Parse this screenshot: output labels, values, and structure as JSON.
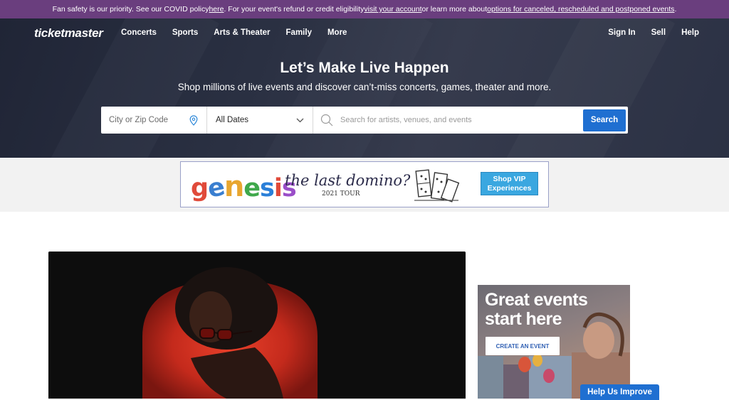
{
  "banner": {
    "text_1": "Fan safety is our priority. See our COVID policy ",
    "link_1": "here",
    "text_2": ". For your event's refund or credit eligibility ",
    "link_2": "visit your account",
    "text_3": " or learn more about ",
    "link_3": "options for canceled, rescheduled and postponed events",
    "text_4": "."
  },
  "nav": {
    "logo": "ticketmaster",
    "left_items": [
      "Concerts",
      "Sports",
      "Arts & Theater",
      "Family",
      "More"
    ],
    "right_items": [
      "Sign In",
      "Sell",
      "Help"
    ]
  },
  "hero": {
    "headline": "Let’s Make Live Happen",
    "subline": "Shop millions of live events and discover can’t-miss concerts, games, theater and more."
  },
  "search": {
    "city_placeholder": "City or Zip Code",
    "date_value": "All Dates",
    "query_placeholder": "Search for artists, venues, and events",
    "button_label": "Search"
  },
  "ad_banner": {
    "brand_letters": [
      "g",
      "e",
      "n",
      "e",
      "s",
      "i",
      "s"
    ],
    "tagline": "the last domino?",
    "tour": "2021 TOUR",
    "cta_line1": "Shop VIP",
    "cta_line2": "Experiences"
  },
  "side_ad": {
    "title_line1": "Great events",
    "title_line2": "start here",
    "button_label": "CREATE AN EVENT"
  },
  "help_button": "Help Us Improve",
  "colors": {
    "banner_bg": "#6a3e7e",
    "hero_bg": "#2a3042",
    "accent_blue": "#1f6fd1",
    "vip_blue": "#3aa7e0"
  }
}
